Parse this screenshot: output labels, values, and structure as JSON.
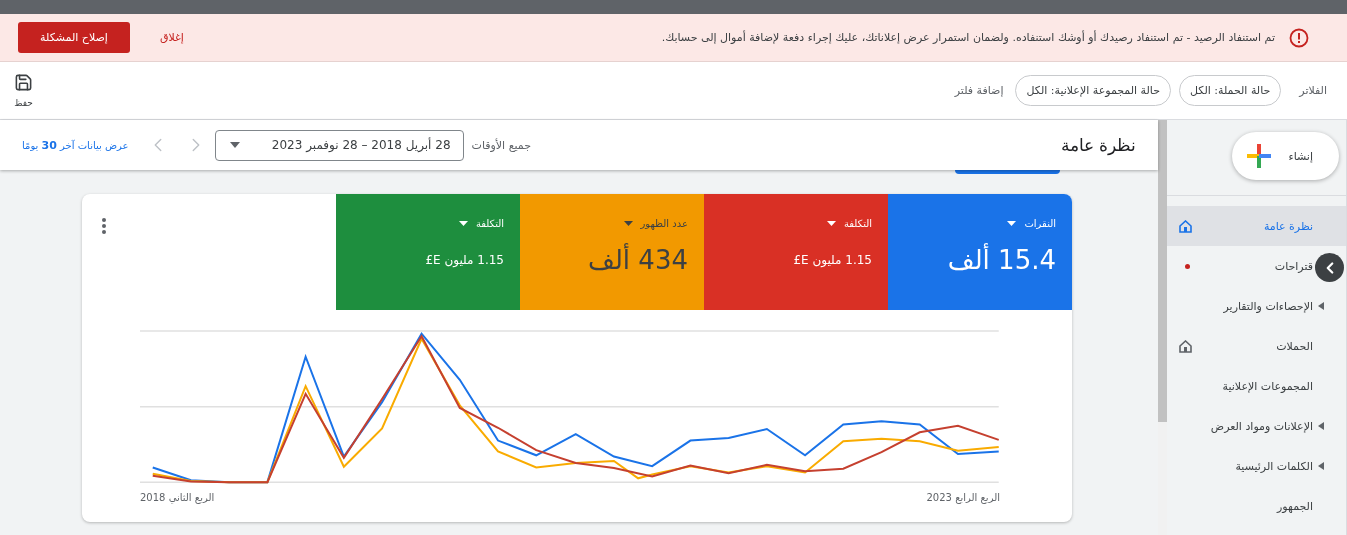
{
  "alert": {
    "message": "تم استنفاد الرصيد - تم استنفاد رصيدك أو أوشك استنفاده. ولضمان استمرار عرض إعلاناتك، عليك إجراء دفعة لإضافة أموال إلى حسابك.",
    "dismiss": "إغلاق",
    "action": "إصلاح المشكلة"
  },
  "filters": {
    "label": "الفلاتر",
    "chips": [
      "حالة الحملة: الكل",
      "حالة المجموعة الإعلانية: الكل"
    ],
    "add": "إضافة فلتر",
    "save": "حفظ"
  },
  "header": {
    "title": "نظرة عامة",
    "range_label": "جميع الأوقات",
    "date_range": "28 أبريل 2018 – 28 نوفمبر 2023",
    "last_30_link": "عرض بيانات آخر **30** يومًا"
  },
  "sidebar": {
    "create": "إنشاء",
    "items": [
      {
        "label": "نظرة عامة",
        "kind": "home",
        "selected": true,
        "notification": false
      },
      {
        "label": "قتراحات",
        "kind": "page",
        "selected": false,
        "notification": true
      },
      {
        "label": "الإحصاءات والتقارير",
        "kind": "group",
        "selected": false,
        "notification": false
      },
      {
        "label": "الحملات",
        "kind": "home",
        "selected": false,
        "notification": false
      },
      {
        "label": "المجموعات الإعلانية",
        "kind": "page",
        "selected": false,
        "notification": false
      },
      {
        "label": "الإعلانات ومواد العرض",
        "kind": "group",
        "selected": false,
        "notification": false
      },
      {
        "label": "الكلمات الرئيسية",
        "kind": "group",
        "selected": false,
        "notification": false
      },
      {
        "label": "الجمهور",
        "kind": "page",
        "selected": false,
        "notification": false
      }
    ]
  },
  "metrics": [
    {
      "label": "النقرات",
      "value": "15.4 ألف",
      "color": "#1a73e8",
      "kind": "large"
    },
    {
      "label": "التكلفة",
      "value": "1.15 مليون E£",
      "color": "#d93025",
      "kind": "compact"
    },
    {
      "label": "عدد الظهور",
      "value": "434 ألف",
      "color": "#f29900",
      "kind": "large"
    },
    {
      "label": "التكلفة",
      "value": "1.15 مليون E£",
      "color": "#1e8e3e",
      "kind": "compact"
    }
  ],
  "chart": {
    "x_labels": [
      "الربع الرابع 2023",
      "الربع الثاني 2018"
    ]
  }
}
